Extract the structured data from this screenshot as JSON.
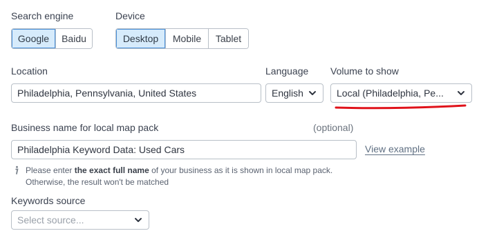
{
  "search_engine": {
    "label": "Search engine",
    "options": [
      "Google",
      "Baidu"
    ],
    "selected": "Google"
  },
  "device": {
    "label": "Device",
    "options": [
      "Desktop",
      "Mobile",
      "Tablet"
    ],
    "selected": "Desktop"
  },
  "location": {
    "label": "Location",
    "value": "Philadelphia, Pennsylvania, United States"
  },
  "language": {
    "label": "Language",
    "value": "English"
  },
  "volume": {
    "label": "Volume to show",
    "value": "Local (Philadelphia, Pe..."
  },
  "business": {
    "label": "Business name for local map pack",
    "optional": "(optional)",
    "value": "Philadelphia Keyword Data: Used Cars",
    "view_example": "View example"
  },
  "hint": {
    "pre": "Please enter ",
    "bold": "the exact full name",
    "post": " of your business as it is shown in local map pack.",
    "line2": "Otherwise, the result won't be matched"
  },
  "keywords_source": {
    "label": "Keywords source",
    "placeholder": "Select source..."
  },
  "colors": {
    "accent": "#4a90d9",
    "active_bg": "#d6ebfb",
    "annotation_red": "#e0121a"
  },
  "icons": {
    "info": "info-icon",
    "chevron": "chevron-down-icon"
  }
}
